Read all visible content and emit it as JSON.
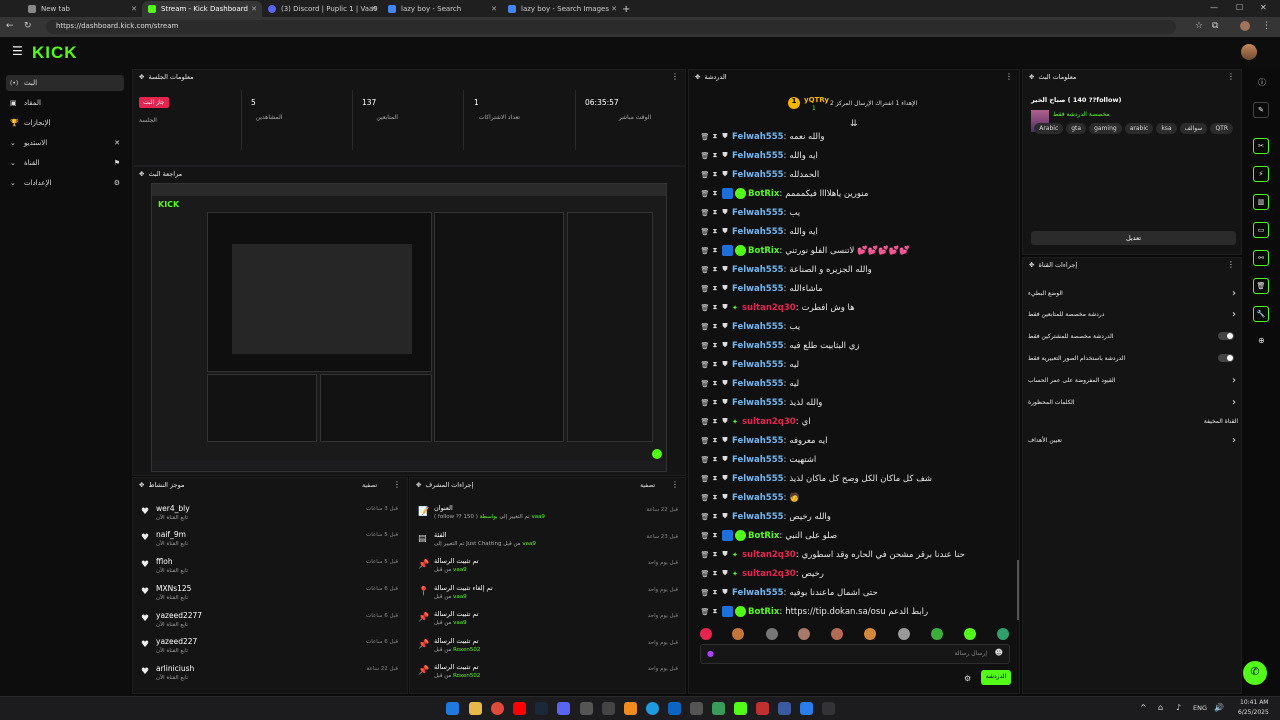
{
  "browser": {
    "tabs": [
      {
        "title": "New tab",
        "color": "#888888"
      },
      {
        "title": "Stream - Kick Dashboard",
        "color": "#53fc18"
      },
      {
        "title": "(3) Discord | Puplic 1 | Vaa9",
        "color": "#5865f2"
      },
      {
        "title": "lazy boy - Search",
        "color": "#4285f4"
      },
      {
        "title": "lazy boy - Search Images",
        "color": "#4285f4"
      }
    ],
    "url": "https://dashboard.kick.com/stream"
  },
  "kick": {
    "logo": "KICK"
  },
  "sidebar": {
    "items": [
      {
        "label": "البث",
        "icon": "(•)"
      },
      {
        "label": "المقاد",
        "icon": "▣"
      },
      {
        "label": "الإنجازات",
        "icon": "🏆"
      },
      {
        "label": "الاستديو",
        "icon": "✕"
      },
      {
        "label": "القناة",
        "icon": "⚑"
      },
      {
        "label": "الإعدادات",
        "icon": "⚙"
      }
    ]
  },
  "session": {
    "header": "معلومات الجلسة",
    "live_badge": "جاز البث",
    "session_label": "الجلسة",
    "stats": [
      {
        "value": "5",
        "label": "المشاهدين"
      },
      {
        "value": "137",
        "label": "المتابعين"
      },
      {
        "value": "1",
        "label": "تعداد الاشتراكات"
      },
      {
        "value": "06:35:57",
        "label": "الوقت مباشر"
      }
    ]
  },
  "preview": {
    "header": "مراجعة البث"
  },
  "activity": {
    "header": "موجز النشاط",
    "filter": "تصفية",
    "rows": [
      {
        "name": "wer4_bly",
        "sub": "تابع القناة الآن",
        "time": "قبل 3 ساعات"
      },
      {
        "name": "naif_9m",
        "sub": "تابع القناة الآن",
        "time": "قبل 5 ساعات"
      },
      {
        "name": "ffloh",
        "sub": "تابع القناة الآن",
        "time": "قبل 5 ساعات"
      },
      {
        "name": "MXNs125",
        "sub": "تابع القناة الآن",
        "time": "قبل 6 ساعات"
      },
      {
        "name": "yazeed2277",
        "sub": "تابع القناة الآن",
        "time": "قبل 6 ساعات"
      },
      {
        "name": "yazeed227",
        "sub": "تابع القناة الآن",
        "time": "قبل 6 ساعات"
      },
      {
        "name": "arliniciush",
        "sub": "تابع القناة الآن",
        "time": "قبل 22 ساعة"
      }
    ]
  },
  "mod": {
    "header": "إجراءات المشرف",
    "filter": "تصفية",
    "rows": [
      {
        "icon": "📝",
        "title": "العنوان",
        "pre": "( follow ?? 150 ) تم التغيير إلى",
        "by": "vaa9",
        "post": "بواسطة",
        "time": "قبل 22 ساعة"
      },
      {
        "icon": "▤",
        "title": "الفئة",
        "pre": "تم التغيير إلى Just Chatting من قبل",
        "by": "vaa9",
        "post": "",
        "time": "قبل 23 ساعة"
      },
      {
        "icon": "📌",
        "title": "تم تثبيت الرسالة",
        "pre": "من قبل",
        "by": "vaa9",
        "post": "",
        "time": "قبل يوم واحد"
      },
      {
        "icon": "📍",
        "title": "تم إلغاء تثبيت الرسالة",
        "pre": "من قبل",
        "by": "vaa9",
        "post": "",
        "time": "قبل يوم واحد"
      },
      {
        "icon": "📌",
        "title": "تم تثبيت الرسالة",
        "pre": "من قبل",
        "by": "vaa9",
        "post": "",
        "time": "قبل يوم واحد"
      },
      {
        "icon": "📌",
        "title": "تم تثبيت الرسالة",
        "pre": "من قبل",
        "by": "Roxen502",
        "post": "",
        "time": "قبل يوم واحد"
      },
      {
        "icon": "📌",
        "title": "تم تثبيت الرسالة",
        "pre": "من قبل",
        "by": "Roxen502",
        "post": "",
        "time": "قبل يوم واحد"
      }
    ]
  },
  "chat": {
    "header": "الدردشة",
    "top_gifter": "yQTRy",
    "top_gifter_count": "1",
    "top_gifter_text": "الإهداء 1 اشتراك الإرسال المركز 2",
    "input_placeholder": "إرسال رسالة",
    "send_label": "الدردشة",
    "messages": [
      {
        "user": "Felwah555",
        "color": "#6fb8f2",
        "bot": false,
        "msg": "والله نعمه"
      },
      {
        "user": "Felwah555",
        "color": "#6fb8f2",
        "bot": false,
        "msg": "ايه والله"
      },
      {
        "user": "Felwah555",
        "color": "#6fb8f2",
        "bot": false,
        "msg": "الحمدلله"
      },
      {
        "user": "BotRix",
        "color": "#53fc18",
        "bot": true,
        "msg": "منورين ياهلاااا فيكمممم"
      },
      {
        "user": "Felwah555",
        "color": "#6fb8f2",
        "bot": false,
        "msg": "يب"
      },
      {
        "user": "Felwah555",
        "color": "#6fb8f2",
        "bot": false,
        "msg": "ايه والله"
      },
      {
        "user": "BotRix",
        "color": "#53fc18",
        "bot": true,
        "msg": "لاتنسى الفلو نورتني 💕💕💕💕💕"
      },
      {
        "user": "Felwah555",
        "color": "#6fb8f2",
        "bot": false,
        "msg": "والله الجزيره و الصناعة"
      },
      {
        "user": "Felwah555",
        "color": "#6fb8f2",
        "bot": false,
        "msg": "ماشاءالله"
      },
      {
        "user": "sultan2q30",
        "color": "#e5254f",
        "bot": false,
        "msg": "ها وش افطرت"
      },
      {
        "user": "Felwah555",
        "color": "#6fb8f2",
        "bot": false,
        "msg": "يب"
      },
      {
        "user": "Felwah555",
        "color": "#6fb8f2",
        "bot": false,
        "msg": "زي البثابيت طلع فيه"
      },
      {
        "user": "Felwah555",
        "color": "#6fb8f2",
        "bot": false,
        "msg": "ليه"
      },
      {
        "user": "Felwah555",
        "color": "#6fb8f2",
        "bot": false,
        "msg": "ليه"
      },
      {
        "user": "Felwah555",
        "color": "#6fb8f2",
        "bot": false,
        "msg": "والله لذيذ"
      },
      {
        "user": "sultan2q30",
        "color": "#e5254f",
        "bot": false,
        "msg": "اي"
      },
      {
        "user": "Felwah555",
        "color": "#6fb8f2",
        "bot": false,
        "msg": "ايه معروفه"
      },
      {
        "user": "Felwah555",
        "color": "#6fb8f2",
        "bot": false,
        "msg": "اشتهيت"
      },
      {
        "user": "Felwah555",
        "color": "#6fb8f2",
        "bot": false,
        "msg": "شف كل ماكان الكل وصح كل ماكان لذيذ"
      },
      {
        "user": "Felwah555",
        "color": "#6fb8f2",
        "bot": false,
        "msg": "🧑"
      },
      {
        "user": "Felwah555",
        "color": "#6fb8f2",
        "bot": false,
        "msg": "والله رخيص"
      },
      {
        "user": "BotRix",
        "color": "#53fc18",
        "bot": true,
        "msg": "صلو على النبي"
      },
      {
        "user": "sultan2q30",
        "color": "#e5254f",
        "bot": false,
        "msg": "حنا عندنا برقر مشحن في الحاره وقد اسطوري"
      },
      {
        "user": "sultan2q30",
        "color": "#e5254f",
        "bot": false,
        "msg": "رخيص"
      },
      {
        "user": "Felwah555",
        "color": "#6fb8f2",
        "bot": false,
        "msg": "حتى اشمال ماعندنا بوفيه"
      },
      {
        "user": "BotRix",
        "color": "#53fc18",
        "bot": true,
        "msg": "https://tip.dokan.sa/osu رابط الدعم"
      }
    ]
  },
  "streaminfo": {
    "header": "معلومات البث",
    "title": "صباح الخير ( 140 ??follow)",
    "category": "مخصصة الدردشة فقط",
    "tags": [
      "QTR",
      "سوالف",
      "ksa",
      "arabic",
      "gaming",
      "gta",
      "Arabic"
    ],
    "edit_label": "تعديل"
  },
  "channel": {
    "header": "إجراءات القناة",
    "options": [
      {
        "label": "الوضع البطيء",
        "kind": "chevron"
      },
      {
        "label": "دردشة مخصصة للمتابعين فقط",
        "kind": "chevron"
      },
      {
        "label": "الدردشة مخصصة للمشتركين فقط",
        "kind": "toggle"
      },
      {
        "label": "الدردشة باستخدام الصور التعبيرية فقط",
        "kind": "toggle"
      },
      {
        "label": "القيود المفروضة على عمر الحساب",
        "kind": "chevron"
      },
      {
        "label": "الكلمات المحظورة",
        "kind": "chevron"
      },
      {
        "label": "القناة المخيفة",
        "kind": "none"
      },
      {
        "label": "تعيين الأهداف",
        "kind": "chevron"
      }
    ]
  },
  "taskbar": {
    "lang": "ENG",
    "time": "10:41 AM",
    "date": "6/25/2025"
  }
}
